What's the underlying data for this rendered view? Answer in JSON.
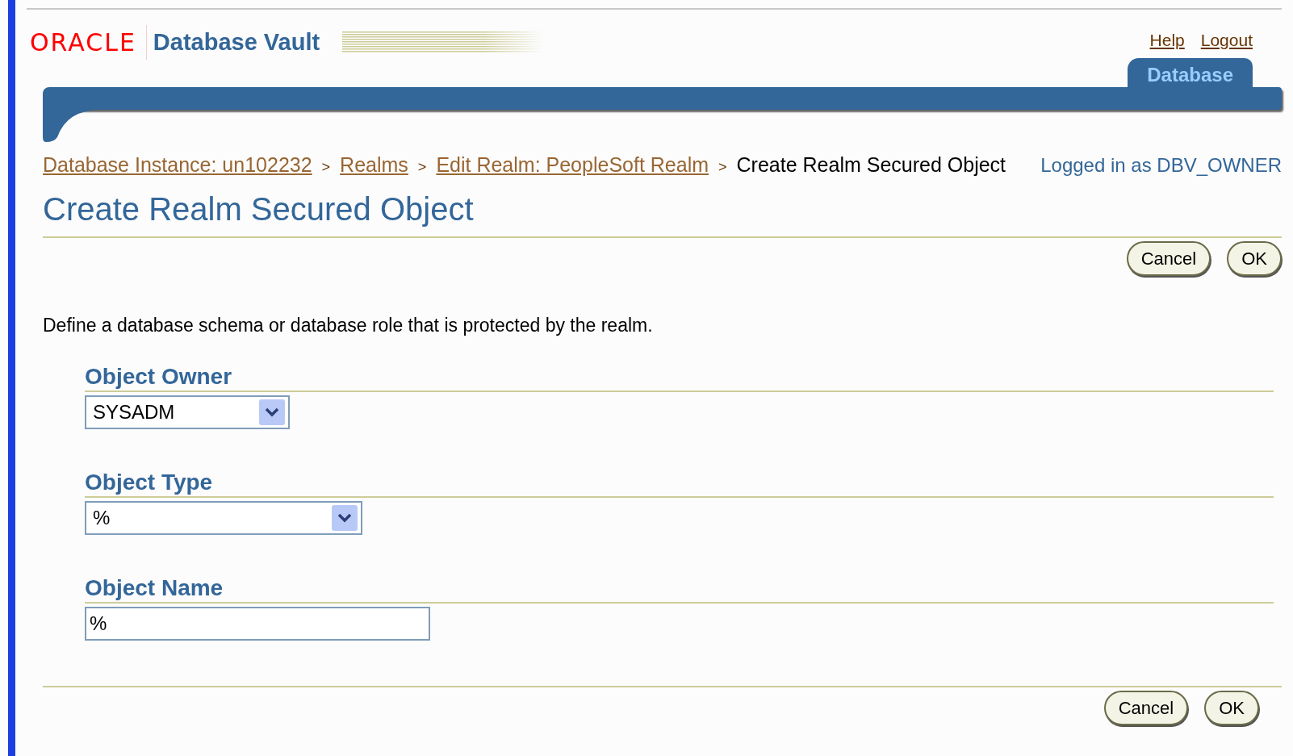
{
  "brand": {
    "logo": "ORACLE",
    "product": "Database Vault"
  },
  "global_links": [
    "Help",
    "Logout"
  ],
  "tabs": [
    {
      "label": "Database",
      "selected": true
    }
  ],
  "breadcrumbs": [
    {
      "label": "Database Instance: un102232",
      "link": true
    },
    {
      "label": "Realms",
      "link": true
    },
    {
      "label": "Edit Realm: PeopleSoft Realm",
      "link": true
    },
    {
      "label": "Create Realm Secured Object",
      "link": false
    }
  ],
  "breadcrumb_separator": ">",
  "user_info": "Logged in as DBV_OWNER",
  "page_title": "Create Realm Secured Object",
  "top_buttons": [
    "Cancel",
    "OK"
  ],
  "description": "Define a database schema or database role that is protected by the realm.",
  "fields": [
    {
      "label": "Object Owner",
      "kind": "select",
      "value": "SYSADM"
    },
    {
      "label": "Object Type",
      "kind": "select",
      "value": "%"
    },
    {
      "label": "Object Name",
      "kind": "text",
      "value": "%"
    }
  ],
  "bottom_buttons": [
    "Cancel",
    "OK"
  ]
}
